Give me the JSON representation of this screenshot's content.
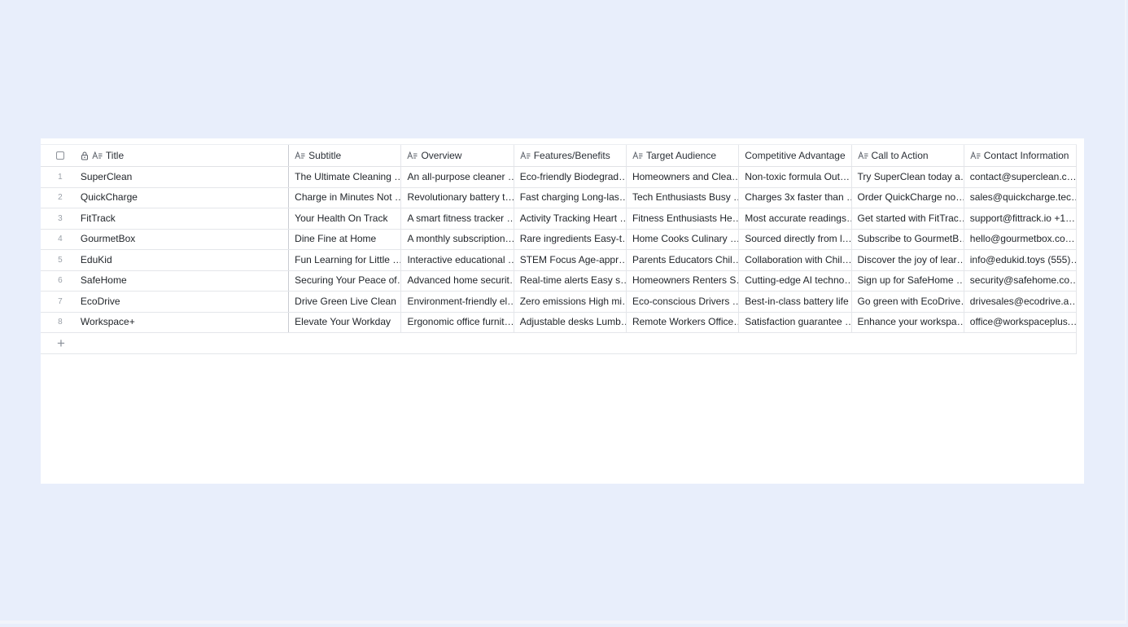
{
  "table": {
    "columns": [
      {
        "key": "title",
        "label": "Title",
        "icon": "text-field-icon",
        "locked": true
      },
      {
        "key": "subtitle",
        "label": "Subtitle",
        "icon": "text-field-icon"
      },
      {
        "key": "overview",
        "label": "Overview",
        "icon": "text-field-icon"
      },
      {
        "key": "features",
        "label": "Features/Benefits",
        "icon": "text-field-icon"
      },
      {
        "key": "audience",
        "label": "Target Audience",
        "icon": "text-field-icon"
      },
      {
        "key": "advantage",
        "label": "Competitive Advantage",
        "icon": ""
      },
      {
        "key": "cta",
        "label": "Call to Action",
        "icon": "text-field-icon"
      },
      {
        "key": "contact",
        "label": "Contact Information",
        "icon": "text-field-icon"
      }
    ],
    "rows": [
      {
        "num": "1",
        "title": "SuperClean",
        "subtitle": "The Ultimate Cleaning …",
        "overview": "An all-purpose cleaner …",
        "features": "Eco-friendly Biodegrad…",
        "audience": "Homeowners and Clea…",
        "advantage": "Non-toxic formula Out…",
        "cta": "Try SuperClean today a…",
        "contact": "contact@superclean.c…"
      },
      {
        "num": "2",
        "title": "QuickCharge",
        "subtitle": "Charge in Minutes Not …",
        "overview": "Revolutionary battery t…",
        "features": "Fast charging Long-las…",
        "audience": "Tech Enthusiasts Busy …",
        "advantage": "Charges 3x faster than …",
        "cta": "Order QuickCharge no…",
        "contact": "sales@quickcharge.tec…"
      },
      {
        "num": "3",
        "title": "FitTrack",
        "subtitle": "Your Health On Track",
        "overview": "A smart fitness tracker …",
        "features": "Activity Tracking Heart …",
        "audience": "Fitness Enthusiasts He…",
        "advantage": "Most accurate readings…",
        "cta": "Get started with FitTrac…",
        "contact": "support@fittrack.io +1…"
      },
      {
        "num": "4",
        "title": "GourmetBox",
        "subtitle": "Dine Fine at Home",
        "overview": "A monthly subscription…",
        "features": "Rare ingredients Easy-t…",
        "audience": "Home Cooks Culinary …",
        "advantage": "Sourced directly from l…",
        "cta": "Subscribe to GourmetB…",
        "contact": "hello@gourmetbox.co…"
      },
      {
        "num": "5",
        "title": "EduKid",
        "subtitle": "Fun Learning for Little …",
        "overview": "Interactive educational …",
        "features": "STEM Focus Age-appr…",
        "audience": "Parents Educators Chil…",
        "advantage": "Collaboration with Chil…",
        "cta": "Discover the joy of lear…",
        "contact": "info@edukid.toys (555)…"
      },
      {
        "num": "6",
        "title": "SafeHome",
        "subtitle": "Securing Your Peace of…",
        "overview": "Advanced home securit…",
        "features": "Real-time alerts Easy s…",
        "audience": "Homeowners Renters S…",
        "advantage": "Cutting-edge AI techno…",
        "cta": "Sign up for SafeHome …",
        "contact": "security@safehome.co…"
      },
      {
        "num": "7",
        "title": "EcoDrive",
        "subtitle": "Drive Green Live Clean",
        "overview": "Environment-friendly el…",
        "features": "Zero emissions High mi…",
        "audience": "Eco-conscious Drivers …",
        "advantage": "Best-in-class battery life",
        "cta": "Go green with EcoDrive…",
        "contact": "drivesales@ecodrive.a…"
      },
      {
        "num": "8",
        "title": "Workspace+",
        "subtitle": "Elevate Your Workday",
        "overview": "Ergonomic office furnit…",
        "features": "Adjustable desks Lumb…",
        "audience": "Remote Workers Office…",
        "advantage": "Satisfaction guarantee …",
        "cta": "Enhance your workspa…",
        "contact": "office@workspaceplus.…"
      }
    ],
    "add_row_label": "+"
  }
}
